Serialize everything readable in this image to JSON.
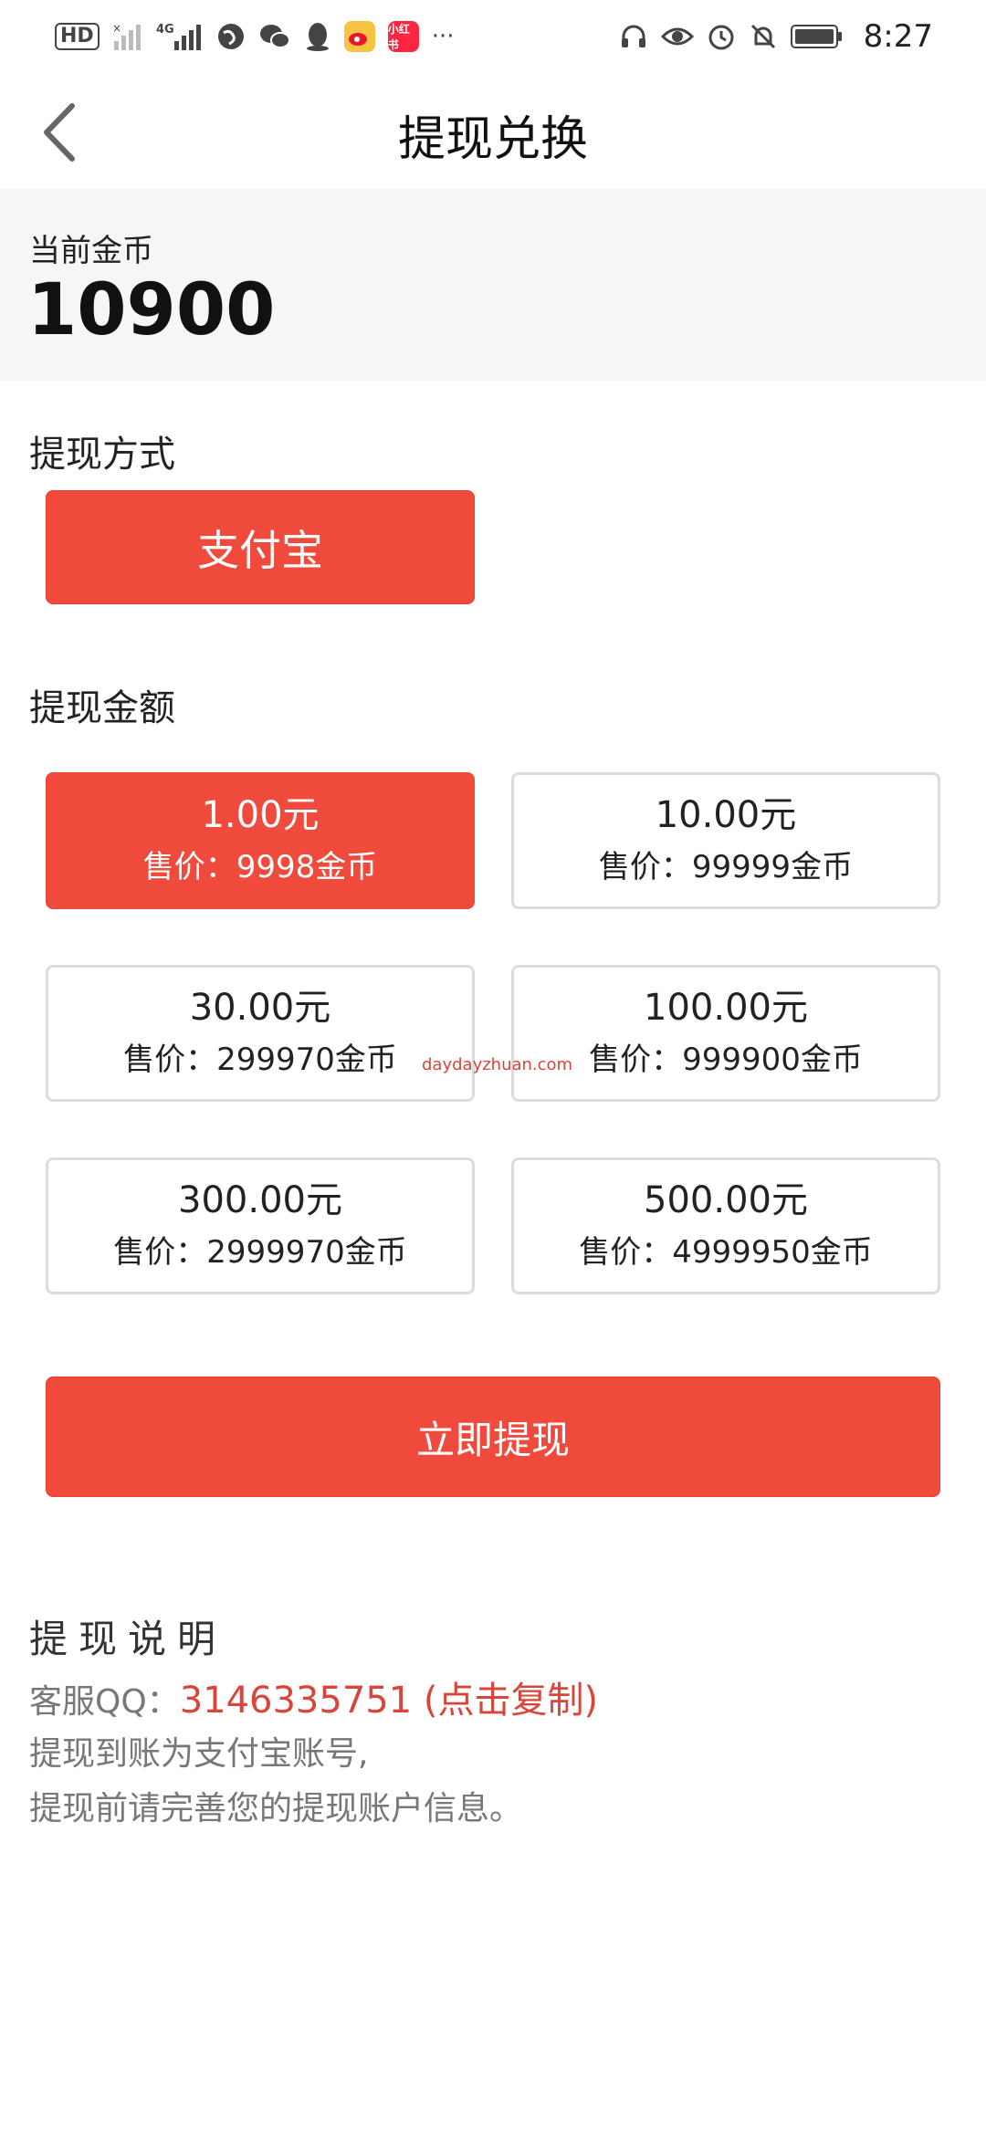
{
  "status_bar": {
    "hd_label": "HD",
    "network_label": "4G",
    "app_badge": "小红书",
    "more": "···",
    "time": "8:27"
  },
  "header": {
    "title": "提现兑换"
  },
  "coins": {
    "label": "当前金币",
    "value": "10900"
  },
  "method": {
    "section_title": "提现方式",
    "option_label": "支付宝"
  },
  "amount": {
    "section_title": "提现金额",
    "options": [
      {
        "value": "1.00元",
        "price": "售价：9998金币",
        "selected": true
      },
      {
        "value": "10.00元",
        "price": "售价：99999金币",
        "selected": false
      },
      {
        "value": "30.00元",
        "price": "售价：299970金币",
        "selected": false
      },
      {
        "value": "100.00元",
        "price": "售价：999900金币",
        "selected": false
      },
      {
        "value": "300.00元",
        "price": "售价：2999970金币",
        "selected": false
      },
      {
        "value": "500.00元",
        "price": "售价：4999950金币",
        "selected": false
      }
    ]
  },
  "watermark": "daydayzhuan.com",
  "submit_label": "立即提现",
  "notes": {
    "title": "提现说明",
    "qq_label": "客服QQ：",
    "qq_number": "3146335751 (点击复制)",
    "line1": "提现到账为支付宝账号,",
    "line2": "提现前请完善您的提现账户信息。"
  },
  "colors": {
    "accent": "#ef4a3c",
    "border": "#dcdcdc",
    "coin_bg": "#f6f6f6"
  }
}
